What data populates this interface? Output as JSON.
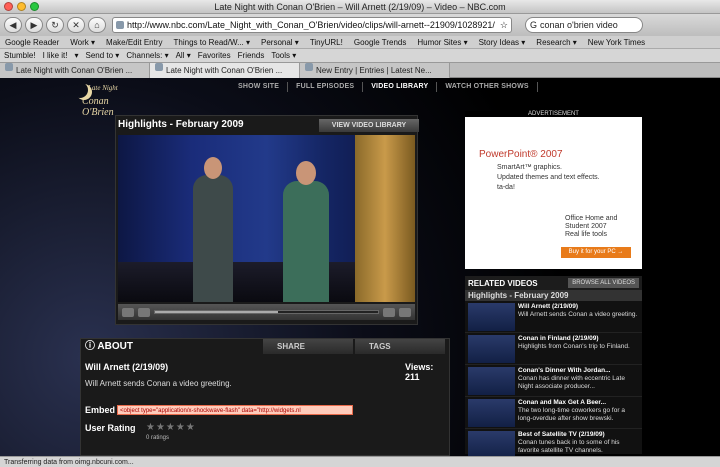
{
  "window": {
    "title": "Late Night with Conan O'Brien – Will Arnett (2/19/09) – Video – NBC.com"
  },
  "nav": {
    "url": "http://www.nbc.com/Late_Night_with_Conan_O'Brien/video/clips/will-arnett--21909/1028921/",
    "search_value": "conan o'brien video"
  },
  "bookmarks": [
    "Google Reader",
    "Work ▾",
    "Make/Edit Entry",
    "Things to Read/W... ▾",
    "Personal ▾",
    "TinyURL!",
    "Google Trends",
    "Humor Sites ▾",
    "Story Ideas ▾",
    "Research ▾",
    "New York Times"
  ],
  "toolbar": [
    "Stumble!",
    "I like it!",
    "▾",
    "Send to ▾",
    "Channels: ▾",
    "All ▾",
    "Favorites",
    "Friends",
    "Tools ▾"
  ],
  "tabs": [
    {
      "label": "Late Night with Conan O'Brien ..."
    },
    {
      "label": "Late Night with Conan O'Brien ..."
    },
    {
      "label": "New Entry | Entries | Latest Ne..."
    }
  ],
  "site": {
    "logo_line1": "Late Night",
    "logo_line2": "Conan O'Brien",
    "nav": [
      "SHOW SITE",
      "FULL EPISODES",
      "VIDEO LIBRARY",
      "WATCH OTHER SHOWS"
    ]
  },
  "player": {
    "title": "Highlights - February 2009",
    "library_button": "VIEW VIDEO LIBRARY",
    "progress": 0.55
  },
  "ad": {
    "label": "ADVERTISEMENT",
    "product": "PowerPoint® 2007",
    "tagline1": "SmartArt™ graphics.",
    "tagline2": "Updated themes and text effects.",
    "tagline3": "ta-da!",
    "office1": "Office Home and",
    "office2": "Student 2007",
    "office3": "Real life tools",
    "buy": "Buy it for your PC →"
  },
  "related": {
    "title": "RELATED VIDEOS",
    "browse": "BROWSE ALL VIDEOS",
    "subtitle": "Highlights - February 2009",
    "items": [
      {
        "title": "Will Arnett (2/19/09)",
        "desc": "Will Arnett sends Conan a video greeting."
      },
      {
        "title": "Conan in Finland (2/19/09)",
        "desc": "Highlights from Conan's trip to Finland."
      },
      {
        "title": "Conan's Dinner With Jordan...",
        "desc": "Conan has dinner with eccentric Late Night associate producer..."
      },
      {
        "title": "Conan and Max Get A Beer...",
        "desc": "The two long-time coworkers go for a long-overdue after show brewski."
      },
      {
        "title": "Best of Satellite TV (2/19/09)",
        "desc": "Conan tunes back in to some of his favorite satellite TV channels."
      }
    ]
  },
  "about": {
    "tab_about": "ABOUT",
    "tab_share": "SHARE",
    "tab_tags": "TAGS",
    "title": "Will Arnett (2/19/09)",
    "views": "Views: 211",
    "description": "Will Arnett sends Conan a video greeting.",
    "embed_label": "Embed",
    "embed_code": "<object type=\"application/x-shockwave-flash\" data=\"http://widgets.nl",
    "rating_label": "User Rating",
    "ratings_count": "0 ratings"
  },
  "status": {
    "text": "Transferring data from oimg.nbcuni.com..."
  }
}
